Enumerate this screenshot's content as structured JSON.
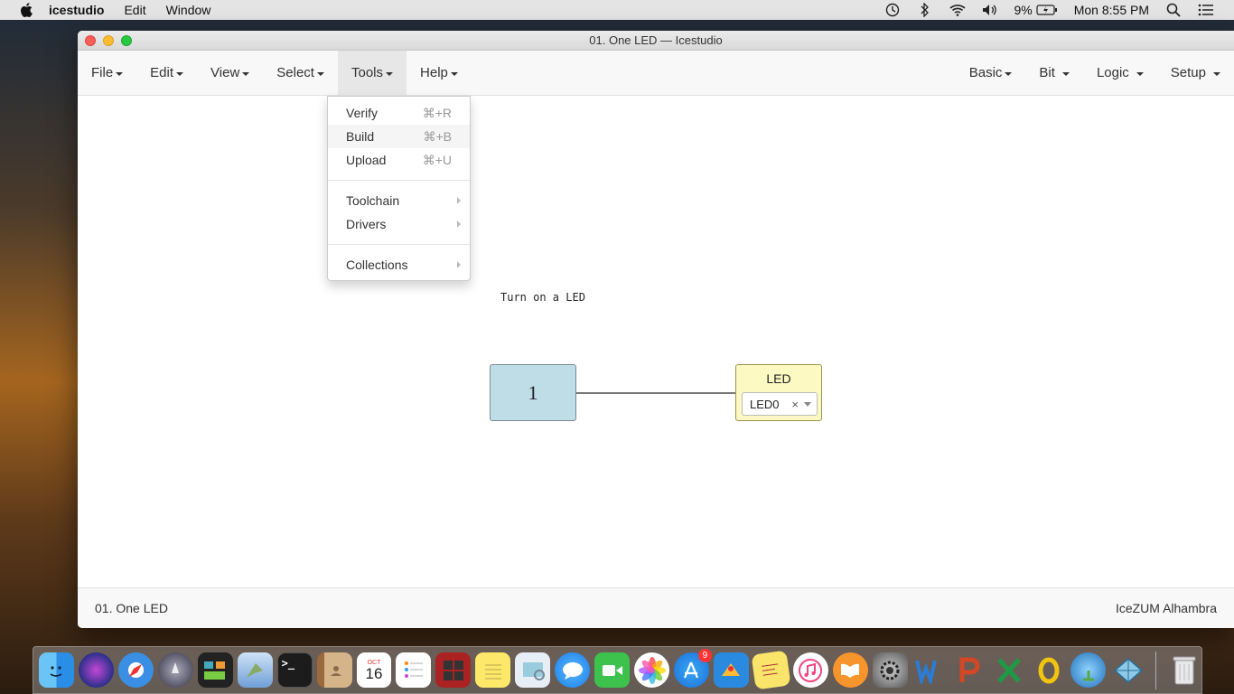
{
  "system_menubar": {
    "app_name": "icestudio",
    "menus": [
      "Edit",
      "Window"
    ],
    "battery": "9%",
    "clock": "Mon 8:55 PM"
  },
  "window": {
    "title": "01. One LED — Icestudio",
    "toolbar_left": [
      "File",
      "Edit",
      "View",
      "Select",
      "Tools",
      "Help"
    ],
    "toolbar_right": [
      "Basic",
      "Bit",
      "Logic",
      "Setup"
    ],
    "active_menu": "Tools"
  },
  "tools_menu": {
    "items": [
      {
        "label": "Verify",
        "shortcut": "⌘+R"
      },
      {
        "label": "Build",
        "shortcut": "⌘+B"
      },
      {
        "label": "Upload",
        "shortcut": "⌘+U"
      },
      {
        "label": "Toolchain"
      },
      {
        "label": "Drivers"
      },
      {
        "label": "Collections"
      }
    ]
  },
  "canvas": {
    "note": "Turn on a LED",
    "constant_value": "1",
    "led_title": "LED",
    "led_pin": "LED0",
    "clear_symbol": "×"
  },
  "footer": {
    "project": "01. One LED",
    "board": "IceZUM Alhambra"
  },
  "dock": {
    "appstore_badge": "9",
    "calendar_month": "OCT",
    "calendar_day": "16",
    "icons": [
      "finder-icon",
      "siri-icon",
      "safari-icon",
      "launchpad-icon",
      "photo-booth-icon",
      "mail-icon",
      "terminal-icon",
      "contacts-icon",
      "calendar-icon",
      "reminders-icon",
      "photobooth-icon",
      "notes-icon",
      "preview-icon",
      "messages-icon",
      "facetime-icon",
      "photos-icon",
      "app-store-icon",
      "stickies-icon",
      "itunes-icon",
      "ibooks-icon",
      "system-preferences-icon",
      "word-icon",
      "powerpoint-icon",
      "excel-icon",
      "outlook-icon",
      "network-icon",
      "icestudio-icon",
      "trash-icon"
    ]
  }
}
